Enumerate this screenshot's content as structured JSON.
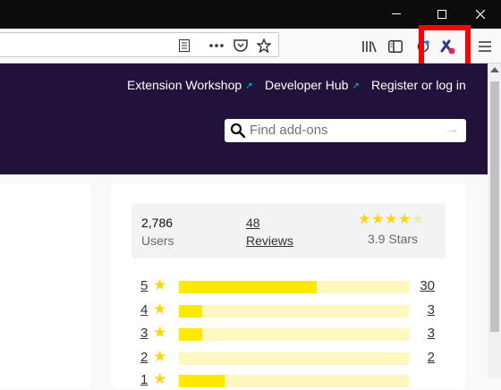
{
  "window": {
    "minimize_icon": "minimize-icon",
    "maximize_icon": "maximize-icon",
    "close_icon": "close-icon"
  },
  "toolbar": {
    "urlbar_icons": [
      "reader-view-icon",
      "page-actions-icon",
      "pocket-icon",
      "bookmark-star-icon"
    ],
    "right_icons": [
      "library-icon",
      "sidebar-icon",
      "extension-puzzle-icon",
      "extension-icon",
      "menu-icon"
    ]
  },
  "header": {
    "links": [
      "Extension Workshop",
      "Developer Hub",
      "Register or log in"
    ],
    "search_placeholder": "Find add-ons"
  },
  "ratings": {
    "users_count": "2,786",
    "users_label": "Users",
    "reviews_count": "48",
    "reviews_label": "Reviews",
    "stars_value": 3.9,
    "stars_text": "3.9 Stars",
    "rows": [
      {
        "stars": "5",
        "count": "30",
        "fraction": 0.6
      },
      {
        "stars": "4",
        "count": "3",
        "fraction": 0.1
      },
      {
        "stars": "3",
        "count": "3",
        "fraction": 0.1
      },
      {
        "stars": "2",
        "count": "2",
        "fraction": 0.0
      },
      {
        "stars": "1",
        "count": "",
        "fraction": 0.2
      }
    ]
  },
  "colors": {
    "header_bg": "#20123a",
    "star_yellow": "#ffd700",
    "bar_fill": "#ffe900",
    "bar_track": "#fff7c0",
    "highlight": "#ff0000",
    "link_icon": "#00c8d7"
  }
}
